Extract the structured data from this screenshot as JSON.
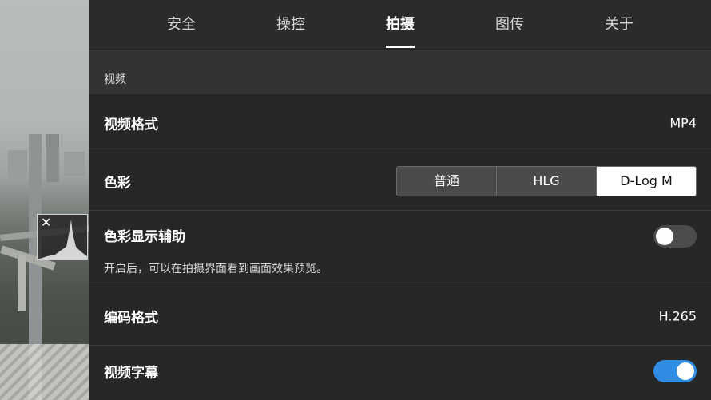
{
  "tabs": [
    {
      "label": "安全",
      "active": false
    },
    {
      "label": "操控",
      "active": false
    },
    {
      "label": "拍摄",
      "active": true
    },
    {
      "label": "图传",
      "active": false
    },
    {
      "label": "关于",
      "active": false
    }
  ],
  "section": {
    "title": "视频"
  },
  "settings": {
    "video_format": {
      "label": "视频格式",
      "value": "MP4"
    },
    "color": {
      "label": "色彩",
      "options": [
        "普通",
        "HLG",
        "D-Log M"
      ],
      "selected": "D-Log M"
    },
    "color_assist": {
      "label": "色彩显示辅助",
      "description": "开启后，可以在拍摄界面看到画面效果预览。",
      "enabled": false
    },
    "encoding_format": {
      "label": "编码格式",
      "value": "H.265"
    },
    "video_subtitles": {
      "label": "视频字幕",
      "enabled": true
    }
  },
  "histogram": {
    "close_glyph": "✕"
  },
  "colors": {
    "accent": "#2f8de4",
    "panel": "#262828",
    "section": "#323333"
  }
}
